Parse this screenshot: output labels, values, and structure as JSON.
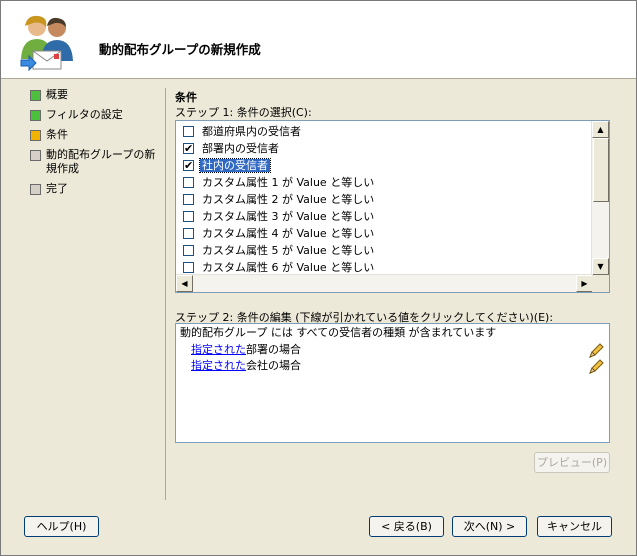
{
  "window": {
    "title": "動的配布グループの新規作成"
  },
  "steps": [
    {
      "label": "概要",
      "color": "#4cbf3c"
    },
    {
      "label": "フィルタの設定",
      "color": "#4cbf3c"
    },
    {
      "label": "条件",
      "color": "#f0b400"
    },
    {
      "label": "動的配布グループの新規作成",
      "color": "#d4d0c8"
    },
    {
      "label": "完了",
      "color": "#d4d0c8"
    }
  ],
  "main": {
    "section_title": "条件",
    "step1_label": "ステップ 1: 条件の選択(C):",
    "conditions": [
      {
        "label": "都道府県内の受信者",
        "checked": false,
        "selected": false
      },
      {
        "label": "部署内の受信者",
        "checked": true,
        "selected": false
      },
      {
        "label": "社内の受信者",
        "checked": true,
        "selected": true
      },
      {
        "label": "カスタム属性 1 が Value と等しい",
        "checked": false,
        "selected": false
      },
      {
        "label": "カスタム属性 2 が Value と等しい",
        "checked": false,
        "selected": false
      },
      {
        "label": "カスタム属性 3 が Value と等しい",
        "checked": false,
        "selected": false
      },
      {
        "label": "カスタム属性 4 が Value と等しい",
        "checked": false,
        "selected": false
      },
      {
        "label": "カスタム属性 5 が Value と等しい",
        "checked": false,
        "selected": false
      },
      {
        "label": "カスタム属性 6 が Value と等しい",
        "checked": false,
        "selected": false
      }
    ],
    "step2_label": "ステップ 2: 条件の編集 (下線が引かれている値をクリックしてください)(E):",
    "condition_text": {
      "line1": "動的配布グループ には すべての受信者の種類 が含まれています",
      "line2_link": "指定された",
      "line2_rest": "部署の場合",
      "line3_link": "指定された",
      "line3_rest": "会社の場合"
    },
    "preview_label": "プレビュー(P)"
  },
  "footer": {
    "help_label": "ヘルプ(H)",
    "back_label": "< 戻る(B)",
    "next_label": "次へ(N) >",
    "cancel_label": "キャンセル"
  }
}
